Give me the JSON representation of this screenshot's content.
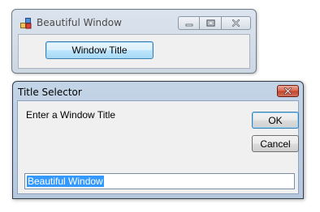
{
  "main_window": {
    "title": "Beautiful Window",
    "icon": "application-icon",
    "controls": [
      "minimize-icon",
      "maximize-icon",
      "close-icon"
    ],
    "button_label": "Window Title"
  },
  "dialog": {
    "title": "Title Selector",
    "prompt": "Enter a Window Title",
    "ok_label": "OK",
    "cancel_label": "Cancel",
    "input_value": "Beautiful Window",
    "input_selected": true,
    "selection_color": "#3399ff",
    "close_color": "#c4422a"
  }
}
